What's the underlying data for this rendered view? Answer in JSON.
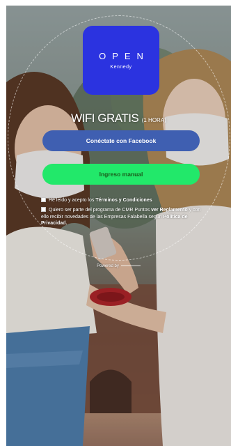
{
  "brand": {
    "name": "OPEN",
    "subtitle": "Kennedy",
    "color": "#2b33e0"
  },
  "headline": {
    "main": "WIFI GRATIS",
    "sub": "(1 HORA)"
  },
  "buttons": {
    "facebook": {
      "label": "Conéctate con Facebook",
      "color": "#3f5fb1"
    },
    "manual": {
      "label": "Ingreso manual",
      "color": "#22e86a"
    }
  },
  "consent": {
    "terms": {
      "prefix": "He leído y acepto los",
      "link": "Términos y Condiciones"
    },
    "program": {
      "text": "Quiero ser parte del programa de CMR Puntos",
      "link1": "ver Reglamento",
      "middle": "y con ello recibir novedades de las Empresas Falabella según",
      "link2": "Política de Privacidad."
    }
  },
  "footer": {
    "powered_by": "Powered by"
  }
}
